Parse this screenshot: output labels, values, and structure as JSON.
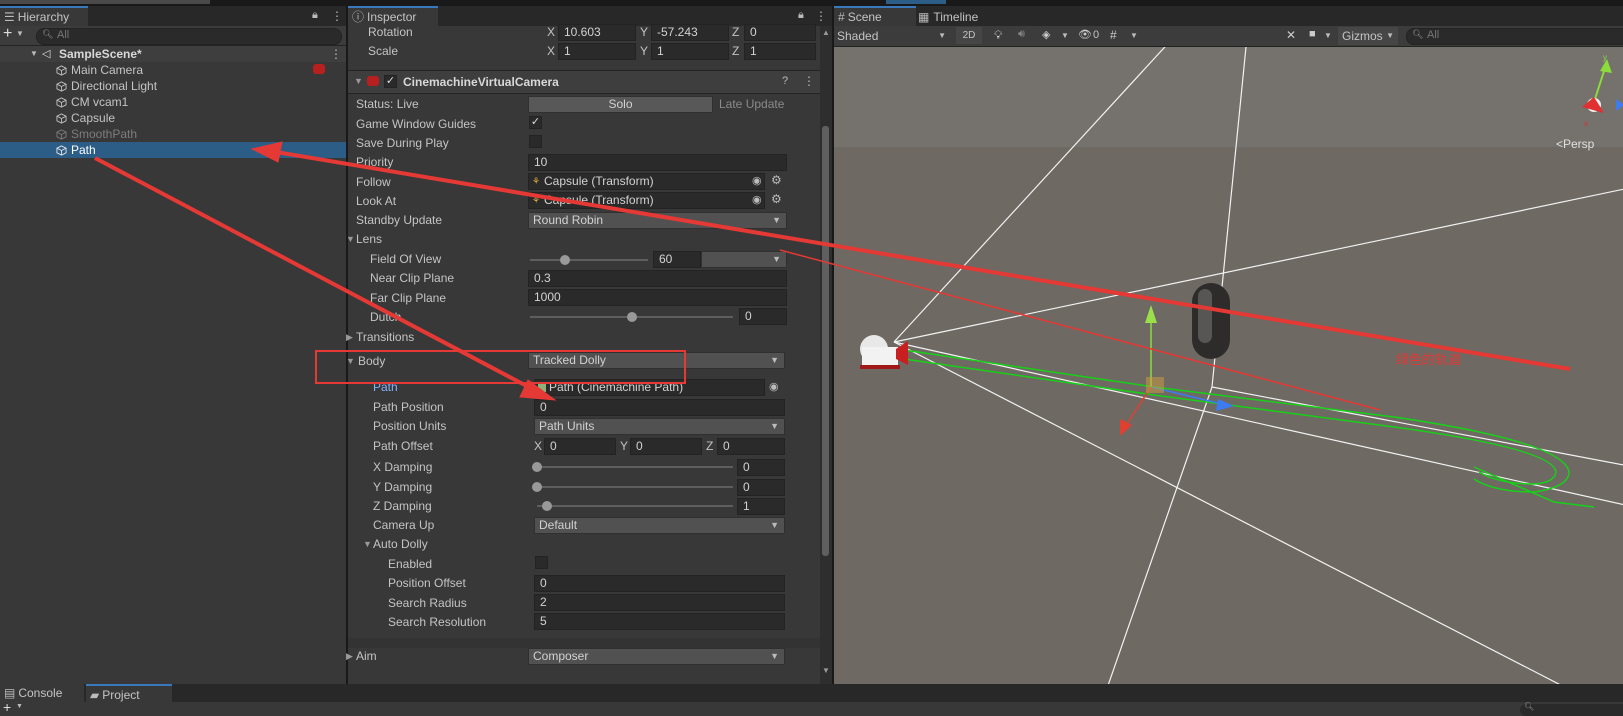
{
  "hierarchy": {
    "tab_label": "Hierarchy",
    "search_placeholder": "All",
    "scene_name": "SampleScene*",
    "items": [
      {
        "label": "Main Camera"
      },
      {
        "label": "Directional Light"
      },
      {
        "label": "CM vcam1"
      },
      {
        "label": "Capsule"
      },
      {
        "label": "SmoothPath"
      },
      {
        "label": "Path"
      }
    ]
  },
  "inspector": {
    "tab_label": "Inspector",
    "transform": {
      "rotation_label": "Rotation",
      "rotation": {
        "x": "10.603",
        "y": "-57.243",
        "z": "0"
      },
      "scale_label": "Scale",
      "scale": {
        "x": "1",
        "y": "1",
        "z": "1"
      },
      "axis_x": "X",
      "axis_y": "Y",
      "axis_z": "Z"
    },
    "component_title": "CinemachineVirtualCamera",
    "status_label": "Status: Live",
    "solo_button": "Solo",
    "late_update": "Late Update",
    "game_window_guides": "Game Window Guides",
    "save_during_play": "Save During Play",
    "priority_label": "Priority",
    "priority_value": "10",
    "follow_label": "Follow",
    "follow_value": "Capsule (Transform)",
    "look_at_label": "Look At",
    "look_at_value": "Capsule (Transform)",
    "standby_label": "Standby Update",
    "standby_value": "Round Robin",
    "lens_label": "Lens",
    "fov_label": "Field Of View",
    "fov_value": "60",
    "fov_level": 0.3,
    "near_label": "Near Clip Plane",
    "near_value": "0.3",
    "far_label": "Far Clip Plane",
    "far_value": "1000",
    "dutch_label": "Dutch",
    "dutch_value": "0",
    "dutch_level": 0.5,
    "transitions_label": "Transitions",
    "body_label": "Body",
    "body_value": "Tracked Dolly",
    "path_label": "Path",
    "path_value": "Path (Cinemachine Path)",
    "path_position_label": "Path Position",
    "path_position_value": "0",
    "position_units_label": "Position Units",
    "position_units_value": "Path Units",
    "path_offset_label": "Path Offset",
    "path_offset": {
      "x": "0",
      "y": "0",
      "z": "0"
    },
    "x_damping_label": "X Damping",
    "x_damping_value": "0",
    "x_damping_level": 0.0,
    "y_damping_label": "Y Damping",
    "y_damping_value": "0",
    "y_damping_level": 0.0,
    "z_damping_label": "Z Damping",
    "z_damping_value": "1",
    "z_damping_level": 0.05,
    "camera_up_label": "Camera Up",
    "camera_up_value": "Default",
    "auto_dolly_label": "Auto Dolly",
    "enabled_label": "Enabled",
    "position_offset_label": "Position Offset",
    "position_offset_value": "0",
    "search_radius_label": "Search Radius",
    "search_radius_value": "2",
    "search_resolution_label": "Search Resolution",
    "search_resolution_value": "5",
    "aim_label": "Aim",
    "aim_value": "Composer"
  },
  "scene": {
    "tab_scene": "Scene",
    "tab_timeline": "Timeline",
    "shading_mode": "Shaded",
    "toggle_2d": "2D",
    "hidden_count": "0",
    "gizmos_label": "Gizmos",
    "search_placeholder": "All",
    "persp_label": "<Persp",
    "annotation": "绿色的轨道"
  },
  "bottom": {
    "tab_console": "Console",
    "tab_project": "Project"
  },
  "colors": {
    "accent": "#3a79bb",
    "selection": "#2c5d87",
    "annotation_red": "#e53935",
    "path_green": "#18d018"
  }
}
